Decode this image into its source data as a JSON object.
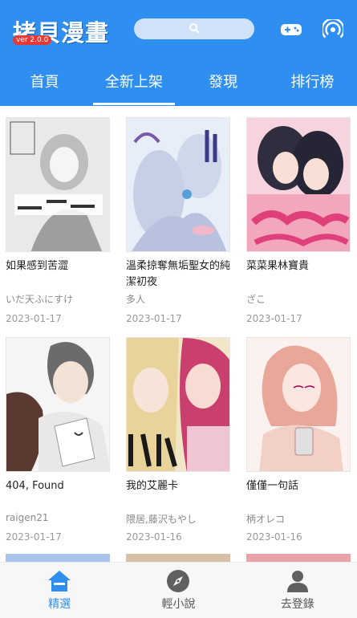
{
  "app": {
    "title": "拷貝漫畫",
    "version": "ver 2.0.0",
    "accent_color": "#2f8ff0",
    "search_icon": "search-icon",
    "gamepad_icon": "gamepad-icon",
    "broadcast_icon": "broadcast-icon"
  },
  "tabs": [
    {
      "label": "首頁",
      "active": false
    },
    {
      "label": "全新上架",
      "active": true
    },
    {
      "label": "發現",
      "active": false
    },
    {
      "label": "排行榜",
      "active": false
    }
  ],
  "comics": [
    {
      "title": "如果感到苦澀",
      "author": "いだ天ふにすけ",
      "date": "2023-01-17",
      "cover_color": "#e9e9e9"
    },
    {
      "title": "溫柔掠奪無垢聖女的純潔初夜",
      "author": "多人",
      "date": "2023-01-17",
      "cover_color": "#dfe7f4"
    },
    {
      "title": "菜菜果林寶貴",
      "author": "ざこ",
      "date": "2023-01-17",
      "cover_color": "#f4c6d3"
    },
    {
      "title": "404, Found",
      "author": "raigen21",
      "date": "2023-01-17",
      "cover_color": "#ededed"
    },
    {
      "title": "我的艾麗卡",
      "author": "隈居,藤沢もやし",
      "date": "2023-01-16",
      "cover_color": "#f0e4c8"
    },
    {
      "title": "僅僅一句話",
      "author": "柄オレコ",
      "date": "2023-01-16",
      "cover_color": "#f6e6e2"
    }
  ],
  "bottom_nav": [
    {
      "label": "精選",
      "icon": "home-icon",
      "active": true
    },
    {
      "label": "輕小說",
      "icon": "compass-icon",
      "active": false
    },
    {
      "label": "去登錄",
      "icon": "user-icon",
      "active": false
    }
  ]
}
